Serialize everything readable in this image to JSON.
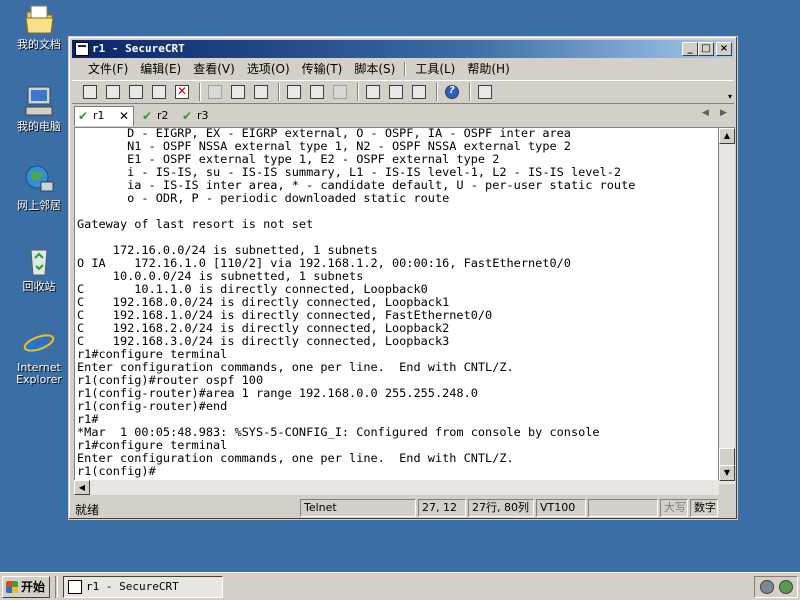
{
  "desktop": {
    "icons": [
      {
        "label": "我的文档",
        "icon": "my-documents-icon"
      },
      {
        "label": "我的电脑",
        "icon": "my-computer-icon"
      },
      {
        "label": "网上邻居",
        "icon": "network-places-icon"
      },
      {
        "label": "回收站",
        "icon": "recycle-bin-icon"
      },
      {
        "label": "Internet Explorer",
        "label_line1": "Internet",
        "label_line2": "Explorer",
        "icon": "internet-explorer-icon"
      }
    ]
  },
  "window": {
    "title": "r1 - SecureCRT",
    "menu": [
      "文件(F)",
      "编辑(E)",
      "查看(V)",
      "选项(O)",
      "传输(T)",
      "脚本(S)",
      "工具(L)",
      "帮助(H)"
    ],
    "tabs": [
      {
        "label": "r1",
        "active": true,
        "close": "✕"
      },
      {
        "label": "r2",
        "active": false
      },
      {
        "label": "r3",
        "active": false
      }
    ],
    "terminal_lines": [
      "       D - EIGRP, EX - EIGRP external, O - OSPF, IA - OSPF inter area",
      "       N1 - OSPF NSSA external type 1, N2 - OSPF NSSA external type 2",
      "       E1 - OSPF external type 1, E2 - OSPF external type 2",
      "       i - IS-IS, su - IS-IS summary, L1 - IS-IS level-1, L2 - IS-IS level-2",
      "       ia - IS-IS inter area, * - candidate default, U - per-user static route",
      "       o - ODR, P - periodic downloaded static route",
      "",
      "Gateway of last resort is not set",
      "",
      "     172.16.0.0/24 is subnetted, 1 subnets",
      "O IA    172.16.1.0 [110/2] via 192.168.1.2, 00:00:16, FastEthernet0/0",
      "     10.0.0.0/24 is subnetted, 1 subnets",
      "C       10.1.1.0 is directly connected, Loopback0",
      "C    192.168.0.0/24 is directly connected, Loopback1",
      "C    192.168.1.0/24 is directly connected, FastEthernet0/0",
      "C    192.168.2.0/24 is directly connected, Loopback2",
      "C    192.168.3.0/24 is directly connected, Loopback3",
      "r1#configure terminal",
      "Enter configuration commands, one per line.  End with CNTL/Z.",
      "r1(config)#router ospf 100",
      "r1(config-router)#area 1 range 192.168.0.0 255.255.248.0",
      "r1(config-router)#end",
      "r1#",
      "*Mar  1 00:05:48.983: %SYS-5-CONFIG_I: Configured from console by console",
      "r1#configure terminal",
      "Enter configuration commands, one per line.  End with CNTL/Z.",
      "r1(config)#"
    ],
    "status": {
      "ready": "就绪",
      "protocol": "Telnet",
      "cursor": "27, 12",
      "size": "27行, 80列",
      "emulation": "VT100",
      "blank": "",
      "caps": "大写",
      "num": "数字"
    }
  },
  "taskbar": {
    "start_label": "开始",
    "task_title": "r1 - SecureCRT"
  }
}
